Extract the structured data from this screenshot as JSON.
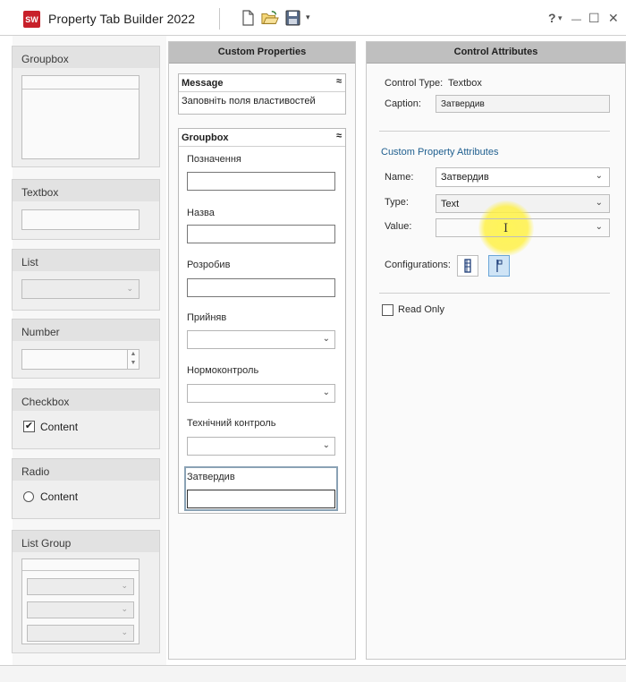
{
  "app": {
    "logo_text": "SW",
    "title": "Property Tab Builder  2022",
    "help_label": "?",
    "help_caret": "▾",
    "minimize": "—",
    "maximize": "☐",
    "close": "✕",
    "icons": [
      "new-document-icon",
      "open-folder-icon",
      "save-icon"
    ]
  },
  "palette": {
    "groupbox": "Groupbox",
    "textbox": "Textbox",
    "list": "List",
    "number": "Number",
    "checkbox": "Checkbox",
    "checkbox_content": "Content",
    "checkbox_checked": true,
    "radio": "Radio",
    "radio_content": "Content",
    "list_group": "List Group"
  },
  "custom_properties": {
    "header": "Custom Properties",
    "message": {
      "title": "Message",
      "text": "Заповніть поля властивостей"
    },
    "groupbox": {
      "title": "Groupbox",
      "fields": [
        {
          "label": "Позначення",
          "kind": "textbox"
        },
        {
          "label": "Назва",
          "kind": "textbox"
        },
        {
          "label": "Розробив",
          "kind": "textbox"
        },
        {
          "label": "Прийняв",
          "kind": "list"
        },
        {
          "label": "Нормоконтроль",
          "kind": "list"
        },
        {
          "label": "Технічний контроль",
          "kind": "list"
        },
        {
          "label": "Затвердив",
          "kind": "textbox",
          "selected": true
        }
      ]
    }
  },
  "control_attributes": {
    "header": "Control Attributes",
    "control_type_label": "Control Type:",
    "control_type_value": "Textbox",
    "caption_label": "Caption:",
    "caption_value": "Затвердив",
    "section_title": "Custom Property Attributes",
    "name_label": "Name:",
    "name_value": "Затвердив",
    "type_label": "Type:",
    "type_value": "Text",
    "value_label": "Value:",
    "value_value": "",
    "configurations_label": "Configurations:",
    "read_only_label": "Read Only",
    "read_only_checked": false,
    "accent_color": "#1f5f8f"
  }
}
